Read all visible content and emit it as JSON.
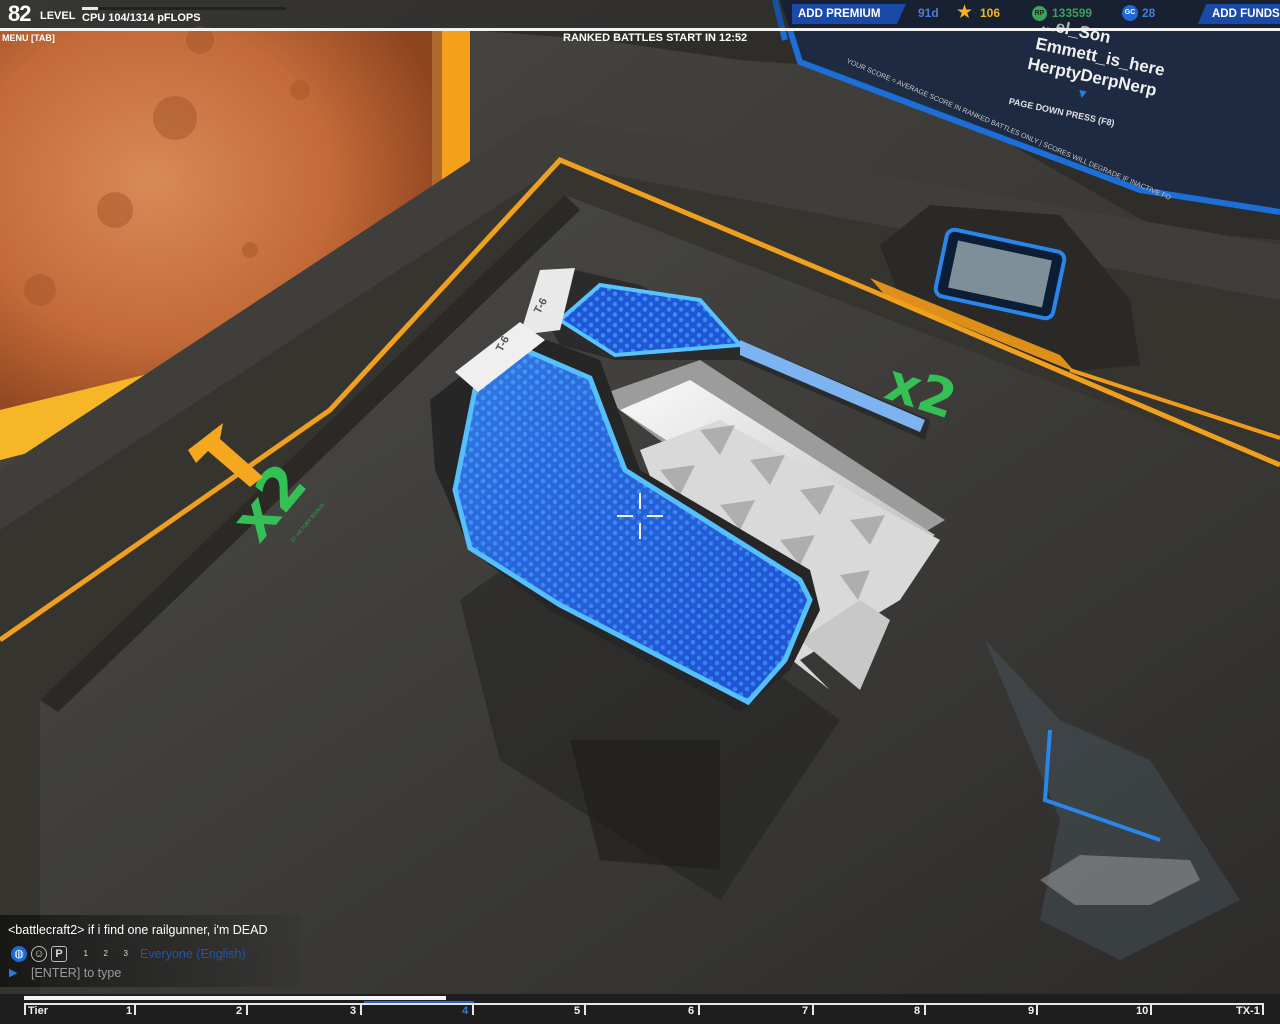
{
  "hud": {
    "level_number": "82",
    "level_label": "LEVEL",
    "cpu": "CPU 104/1314 pFLOPS",
    "cpu_fraction": 0.079,
    "menu": "MENU [TAB]",
    "ranked_timer": "RANKED BATTLES START IN 12:52",
    "premium_button": "ADD PREMIUM",
    "premium_days": "91d",
    "stars": "106",
    "rp_icon": "RP",
    "robits": "133599",
    "gc_icon": "GC",
    "gc": "28",
    "funds_button": "ADD FUNDS"
  },
  "leaderboard": {
    "entries": [
      "...el_Son",
      "Emmett_is_here",
      "HerptyDerpNerp"
    ],
    "arrow": "▼",
    "page_down": "PAGE DOWN PRESS (F8)",
    "note": "YOUR SCORE = AVERAGE SCORE IN RANKED BATTLES ONLY | SCORES WILL DEGRADE IF INACTIVE FO"
  },
  "world": {
    "tier_tag": "T-6",
    "bonus": "x2",
    "bonus_sub": "ST VICTORY BONUS"
  },
  "chat": {
    "message": "<battlecraft2> if i find one railgunner, i'm DEAD",
    "icons": [
      "globe-icon",
      "person-circle-icon",
      "p-icon",
      "party-1-icon",
      "party-2-icon",
      "party-3-icon"
    ],
    "icon_glyphs": [
      "◍",
      "☺",
      "P",
      "1",
      "2",
      "3"
    ],
    "channel": "Everyone (English)",
    "hint": "[ENTER] to type"
  },
  "tiers": {
    "labels": [
      "Tier",
      "1",
      "2",
      "3",
      "4",
      "5",
      "6",
      "7",
      "8",
      "9",
      "10",
      "TX-1"
    ],
    "current_index": 4,
    "progress_fraction": 0.34
  },
  "colors": {
    "accent_blue": "#1a4aa8",
    "stars_gold": "#f5b520",
    "robits_green": "#3ea05a",
    "gc_blue": "#3b7fe0",
    "bonus_green": "#35c055",
    "floor_yellow": "#f0a020"
  }
}
